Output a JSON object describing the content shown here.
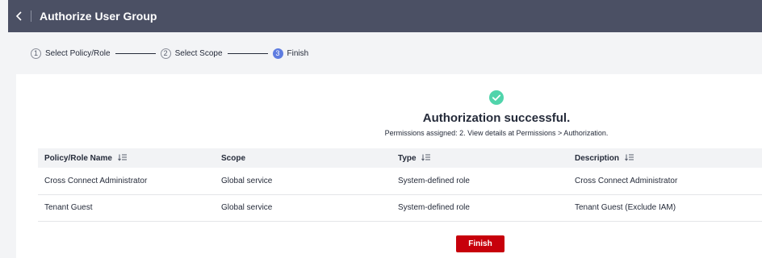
{
  "header": {
    "title": "Authorize User Group",
    "back_icon": "chevron-left-icon"
  },
  "steps": [
    {
      "number": "1",
      "label": "Select Policy/Role",
      "active": false
    },
    {
      "number": "2",
      "label": "Select Scope",
      "active": false
    },
    {
      "number": "3",
      "label": "Finish",
      "active": true
    }
  ],
  "result": {
    "icon": "check-circle-icon",
    "title": "Authorization successful.",
    "subtitle": "Permissions assigned: 2. View details at Permissions > Authorization."
  },
  "table": {
    "columns": [
      "Policy/Role Name",
      "Scope",
      "Type",
      "Description"
    ],
    "sortable": [
      true,
      false,
      true,
      true
    ],
    "rows": [
      [
        "Cross Connect Administrator",
        "Global service",
        "System-defined role",
        "Cross Connect Administrator"
      ],
      [
        "Tenant Guest",
        "Global service",
        "System-defined role",
        "Tenant Guest (Exclude IAM)"
      ]
    ]
  },
  "finish_button": {
    "label": "Finish"
  },
  "colors": {
    "header_bg": "#4b5064",
    "active_step": "#5e7ce0",
    "success": "#50d4ab",
    "primary_button": "#c7000b"
  }
}
